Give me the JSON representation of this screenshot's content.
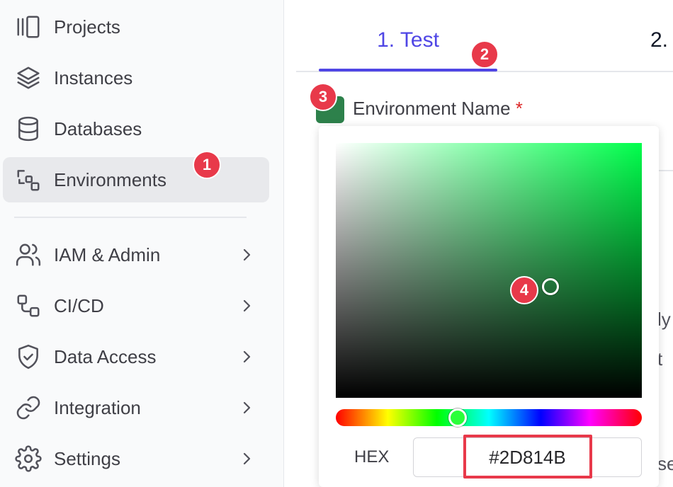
{
  "sidebar": {
    "items": [
      {
        "label": "Projects",
        "icon": "projects-icon"
      },
      {
        "label": "Instances",
        "icon": "layers-icon"
      },
      {
        "label": "Databases",
        "icon": "database-icon"
      },
      {
        "label": "Environments",
        "icon": "environments-icon",
        "active": true
      },
      {
        "label": "IAM & Admin",
        "icon": "users-icon"
      },
      {
        "label": "CI/CD",
        "icon": "workflow-icon"
      },
      {
        "label": "Data Access",
        "icon": "shield-icon"
      },
      {
        "label": "Integration",
        "icon": "link-icon"
      },
      {
        "label": "Settings",
        "icon": "gear-icon"
      }
    ]
  },
  "tabs": {
    "tab1": "1. Test",
    "tab2": "2."
  },
  "form": {
    "label": "Environment Name",
    "required_mark": "*",
    "swatch_color": "#2D814B"
  },
  "background_fragments": [
    "ly",
    "t",
    "se"
  ],
  "color_picker": {
    "hex_label": "HEX",
    "hex_value": "#2D814B",
    "hue_color": "#00ff4c"
  },
  "annotations": [
    "1",
    "2",
    "3",
    "4"
  ],
  "colors": {
    "accent": "#4f46e5",
    "badge": "#e8394a",
    "selected": "#2D814B"
  }
}
